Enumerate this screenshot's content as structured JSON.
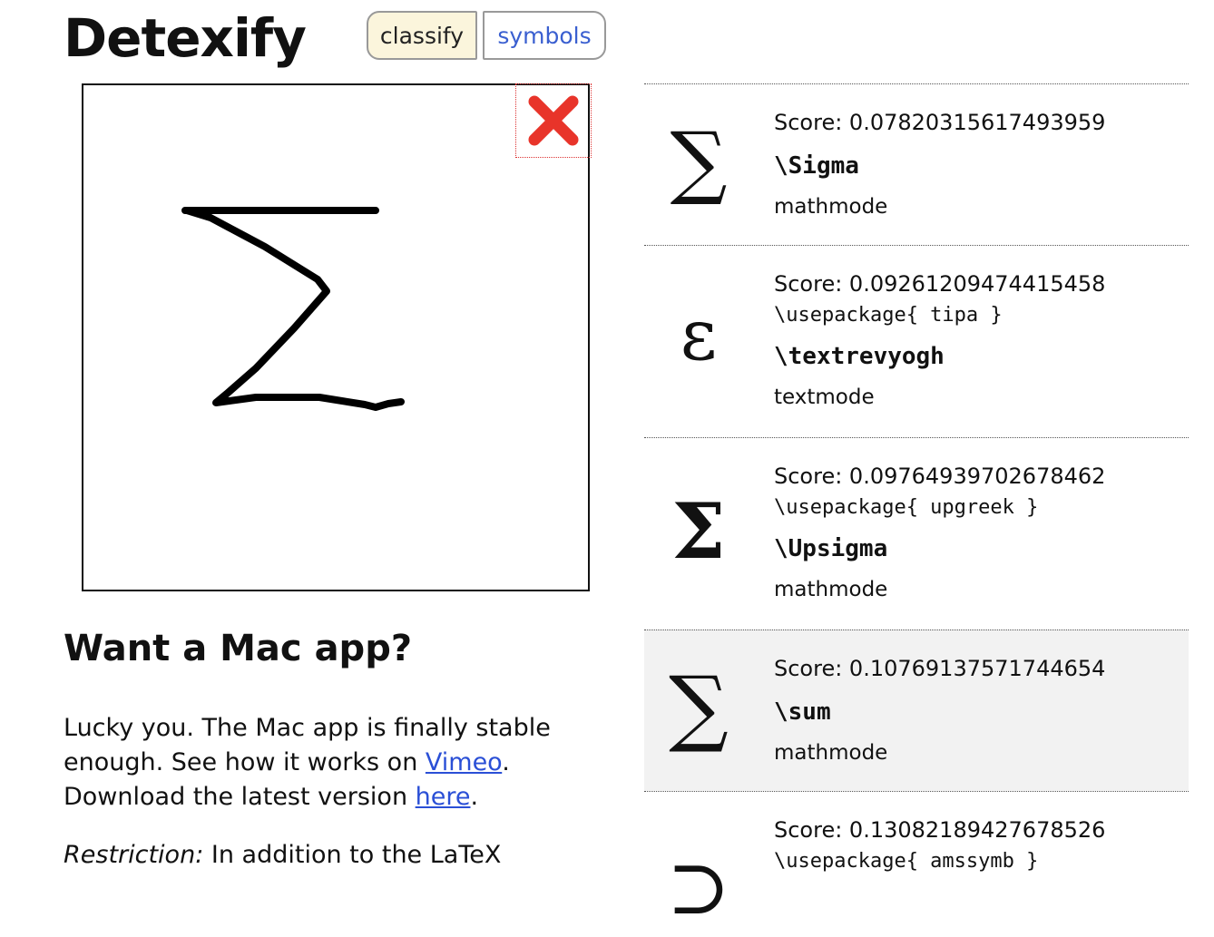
{
  "header": {
    "title": "Detexify",
    "nav": {
      "classify_label": "classify",
      "symbols_label": "symbols"
    }
  },
  "canvas": {
    "clear_icon": "close-icon",
    "clear_color": "#e8342a"
  },
  "mac_section": {
    "heading": "Want a Mac app?",
    "text_1": "Lucky you. The Mac app is finally stable enough. See how it works on ",
    "vimeo_link": "Vimeo",
    "text_2": ". Download the latest version ",
    "here_link": "here",
    "text_3": ".",
    "restriction_label": "Restriction:",
    "restriction_text": " In addition to the LaTeX"
  },
  "results": [
    {
      "glyph": "∑",
      "score": "Score: 0.07820315617493959",
      "package": "",
      "command": "\\Sigma",
      "mode": "mathmode"
    },
    {
      "glyph": "ɛ",
      "score": "Score: 0.09261209474415458",
      "package": "\\usepackage{ tipa }",
      "command": "\\textrevyogh",
      "mode": "textmode"
    },
    {
      "glyph": "Σ",
      "score": "Score: 0.09764939702678462",
      "package": "\\usepackage{ upgreek }",
      "command": "\\Upsigma",
      "mode": "mathmode"
    },
    {
      "glyph": "∑",
      "score": "Score: 0.10769137571744654",
      "package": "",
      "command": "\\sum",
      "mode": "mathmode"
    },
    {
      "glyph": "⊃",
      "score": "Score: 0.13082189427678526",
      "package": "\\usepackage{ amssymb }",
      "command": "",
      "mode": ""
    }
  ]
}
